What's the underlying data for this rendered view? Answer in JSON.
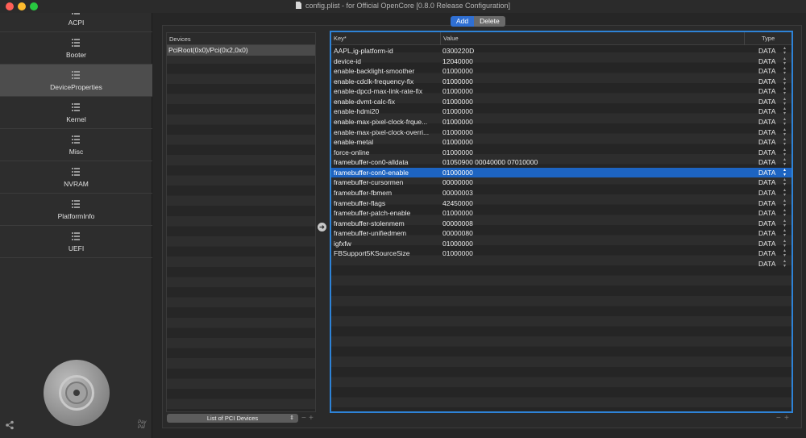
{
  "window": {
    "title": "config.plist - for Official OpenCore [0.8.0 Release Configuration]"
  },
  "sidebar": {
    "items": [
      {
        "label": "ACPI",
        "active": false
      },
      {
        "label": "Booter",
        "active": false
      },
      {
        "label": "DeviceProperties",
        "active": true
      },
      {
        "label": "Kernel",
        "active": false
      },
      {
        "label": "Misc",
        "active": false
      },
      {
        "label": "NVRAM",
        "active": false
      },
      {
        "label": "PlatformInfo",
        "active": false
      },
      {
        "label": "UEFI",
        "active": false
      }
    ],
    "paypal_label": "Pay Pal"
  },
  "toolbar": {
    "add_label": "Add",
    "delete_label": "Delete"
  },
  "devices": {
    "header": "Devices",
    "rows": [
      "PciRoot(0x0)/Pci(0x2,0x0)"
    ],
    "select_label": "List of PCI Devices",
    "minus": "−",
    "plus": "+"
  },
  "properties": {
    "columns": {
      "key": "Key*",
      "value": "Value",
      "type": "Type"
    },
    "selected_index": 12,
    "rows": [
      {
        "key": "AAPL,ig-platform-id",
        "value": "0300220D",
        "type": "DATA"
      },
      {
        "key": "device-id",
        "value": "12040000",
        "type": "DATA"
      },
      {
        "key": "enable-backlight-smoother",
        "value": "01000000",
        "type": "DATA"
      },
      {
        "key": "enable-cdclk-frequency-fix",
        "value": "01000000",
        "type": "DATA"
      },
      {
        "key": "enable-dpcd-max-link-rate-fix",
        "value": "01000000",
        "type": "DATA"
      },
      {
        "key": "enable-dvmt-calc-fix",
        "value": "01000000",
        "type": "DATA"
      },
      {
        "key": "enable-hdmi20",
        "value": "01000000",
        "type": "DATA"
      },
      {
        "key": "enable-max-pixel-clock-frque...",
        "value": "01000000",
        "type": "DATA"
      },
      {
        "key": "enable-max-pixel-clock-overri...",
        "value": "01000000",
        "type": "DATA"
      },
      {
        "key": "enable-metal",
        "value": "01000000",
        "type": "DATA"
      },
      {
        "key": "force-online",
        "value": "01000000",
        "type": "DATA"
      },
      {
        "key": "framebuffer-con0-alldata",
        "value": "01050900 00040000 07010000",
        "type": "DATA"
      },
      {
        "key": "framebuffer-con0-enable",
        "value": "01000000",
        "type": "DATA"
      },
      {
        "key": "framebuffer-cursormen",
        "value": "00000000",
        "type": "DATA"
      },
      {
        "key": "framebuffer-fbmem",
        "value": "00000003",
        "type": "DATA"
      },
      {
        "key": "framebuffer-flags",
        "value": "42450000",
        "type": "DATA"
      },
      {
        "key": "framebuffer-patch-enable",
        "value": "01000000",
        "type": "DATA"
      },
      {
        "key": "framebuffer-stolenmem",
        "value": "00000008",
        "type": "DATA"
      },
      {
        "key": "framebuffer-unifiedmem",
        "value": "00000080",
        "type": "DATA"
      },
      {
        "key": "igfxfw",
        "value": "01000000",
        "type": "DATA"
      },
      {
        "key": "FBSupport5KSourceSize",
        "value": "01000000",
        "type": "DATA"
      },
      {
        "key": "",
        "value": "",
        "type": "DATA"
      }
    ],
    "minus": "−",
    "plus": "+"
  },
  "icons": {
    "nav": "list-icon",
    "share": "share-icon",
    "move": "arrow-right-circle-icon",
    "stepper": "stepper-icon"
  },
  "colors": {
    "accent": "#2f6fd3",
    "selection": "#1d64c2",
    "table_border": "#2e83d7"
  }
}
